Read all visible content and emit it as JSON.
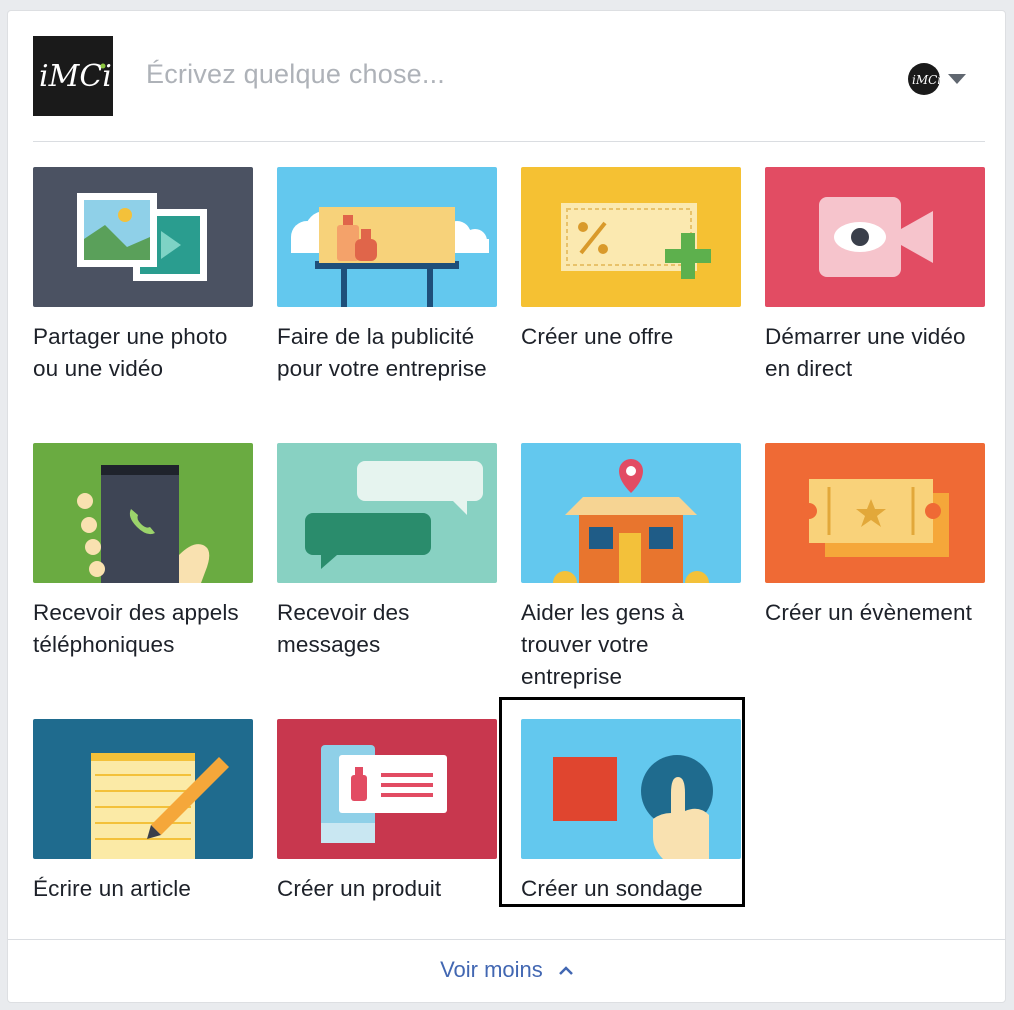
{
  "composer": {
    "logo_text": "iMCi",
    "placeholder": "Écrivez quelque chose..."
  },
  "actions": [
    {
      "label": "Partager une photo ou une vidéo",
      "icon": "photo-video-icon"
    },
    {
      "label": "Faire de la publicité pour votre entreprise",
      "icon": "billboard-icon"
    },
    {
      "label": "Créer une offre",
      "icon": "offer-coupon-icon"
    },
    {
      "label": "Démarrer une vidéo en direct",
      "icon": "live-video-eye-icon"
    },
    {
      "label": "Recevoir des appels téléphoniques",
      "icon": "phone-call-icon"
    },
    {
      "label": "Recevoir des messages",
      "icon": "message-bubbles-icon"
    },
    {
      "label": "Aider les gens à trouver votre entreprise",
      "icon": "storefront-location-icon"
    },
    {
      "label": "Créer un évènement",
      "icon": "event-ticket-icon"
    },
    {
      "label": "Écrire un article",
      "icon": "notepad-pencil-icon"
    },
    {
      "label": "Créer un produit",
      "icon": "product-card-icon"
    },
    {
      "label": "Créer un sondage",
      "icon": "poll-choice-icon"
    }
  ],
  "footer": {
    "see_less_label": "Voir moins"
  },
  "colors": {
    "link": "#4267b2",
    "placeholder": "#aeb2b8",
    "selection_outline": "#000000"
  }
}
